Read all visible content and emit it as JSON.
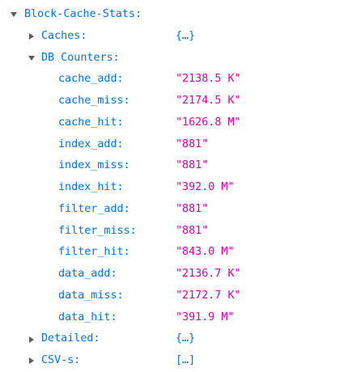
{
  "tree": {
    "root": {
      "label": "Block-Cache-Stats:",
      "expanded": true,
      "twisty_icon": "chevron-down-icon"
    },
    "caches": {
      "label": "Caches:",
      "value": "{…}",
      "expanded": false,
      "twisty_icon": "chevron-right-icon"
    },
    "db_counters": {
      "label": "DB Counters:",
      "expanded": true,
      "twisty_icon": "chevron-down-icon",
      "items": [
        {
          "key": "cache_add:",
          "value": "\"2138.5 K\""
        },
        {
          "key": "cache_miss:",
          "value": "\"2174.5 K\""
        },
        {
          "key": "cache_hit:",
          "value": "\"1626.8 M\""
        },
        {
          "key": "index_add:",
          "value": "\"881\""
        },
        {
          "key": "index_miss:",
          "value": "\"881\""
        },
        {
          "key": "index_hit:",
          "value": "\"392.0 M\""
        },
        {
          "key": "filter_add:",
          "value": "\"881\""
        },
        {
          "key": "filter_miss:",
          "value": "\"881\""
        },
        {
          "key": "filter_hit:",
          "value": "\"843.0 M\""
        },
        {
          "key": "data_add:",
          "value": "\"2136.7 K\""
        },
        {
          "key": "data_miss:",
          "value": "\"2172.7 K\""
        },
        {
          "key": "data_hit:",
          "value": "\"391.9 M\""
        }
      ]
    },
    "detailed": {
      "label": "Detailed:",
      "value": "{…}",
      "expanded": false,
      "twisty_icon": "chevron-right-icon"
    },
    "csv": {
      "label": "CSV-s:",
      "value": "[…]",
      "expanded": false,
      "twisty_icon": "chevron-right-icon"
    }
  },
  "colors": {
    "key": "#0074e8",
    "string_value": "#dd00a9",
    "twisty": "#5b5b66",
    "background": "#ffffff"
  }
}
